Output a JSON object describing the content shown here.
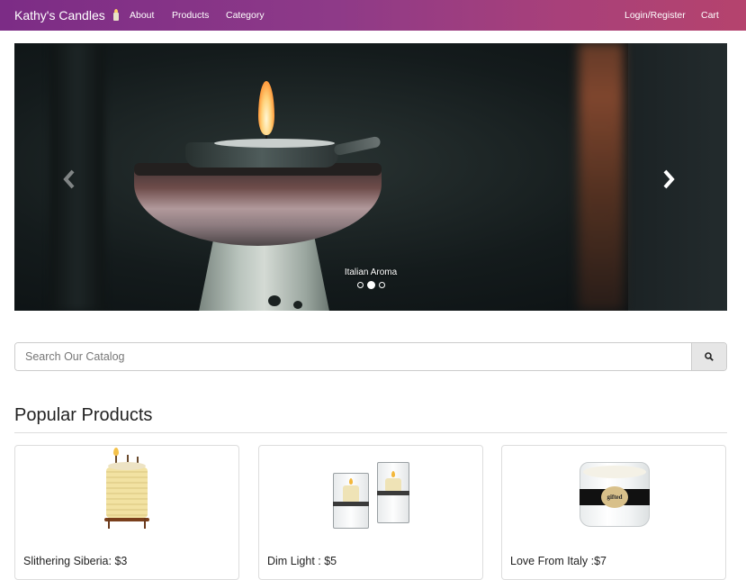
{
  "navbar": {
    "brand": "Kathy's Candles",
    "brand_icon": "candle-icon",
    "links": [
      "About",
      "Products",
      "Category"
    ],
    "login": "Login/Register",
    "cart": "Cart",
    "gradient_start": "#7c2c86",
    "gradient_end": "#b5436d"
  },
  "carousel": {
    "caption": "Italian Aroma",
    "slide_count": 3,
    "active_slide": 2,
    "prev_icon": "chevron-left-icon",
    "next_icon": "chevron-right-icon"
  },
  "search": {
    "placeholder": "Search Our Catalog",
    "button_icon": "search-icon"
  },
  "popular": {
    "title": "Popular Products",
    "products": [
      {
        "label": "Slithering Siberia: $3"
      },
      {
        "label": "Dim Light : $5"
      },
      {
        "label": "Love From Italy :$7",
        "jar_label": "gifted"
      }
    ]
  }
}
